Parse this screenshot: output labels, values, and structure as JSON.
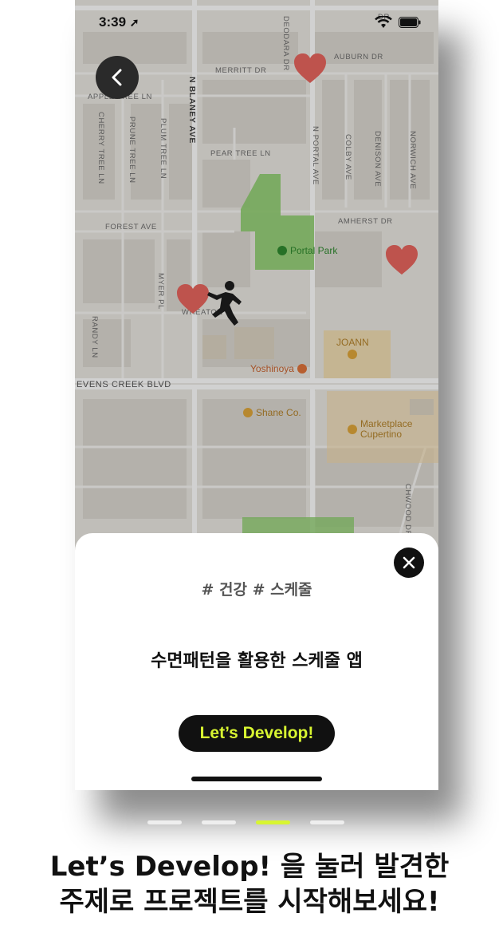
{
  "status_bar": {
    "time": "3:39"
  },
  "map": {
    "streets": {
      "merritt": "MERRITT DR",
      "auburn": "AUBURN DR",
      "apple_tree": "APPLE TREE LN",
      "deodara": "DEODARA DR",
      "dr_top": "DR",
      "n_blaney": "N BLANEY AVE",
      "cherry_tree": "CHERRY TREE LN",
      "prune_tree": "PRUNE TREE LN",
      "plum_tree": "PLUM TREE LN",
      "pear_tree": "PEAR TREE LN",
      "n_portal": "N PORTAL AVE",
      "colby": "COLBY AVE",
      "denison": "DENISON AVE",
      "norwich": "NORWICH AVE",
      "forest": "FOREST AVE",
      "amherst": "AMHERST DR",
      "myer": "MYER PL",
      "wheaton": "WHEATON",
      "randy": "RANDY LN",
      "stevens_creek": "EVENS CREEK BLVD",
      "wood": "CHWOOD DR"
    },
    "pois": {
      "portal_park": "Portal Park",
      "joann": "JOANN",
      "yoshinoya": "Yoshinoya",
      "shane": "Shane Co.",
      "marketplace_1": "Marketplace",
      "marketplace_2": "Cupertino"
    }
  },
  "sheet": {
    "tags": "# 건강 # 스케줄",
    "title": "수면패턴을 활용한 스케줄 앱",
    "button_label": "Let’s Develop!"
  },
  "pager": {
    "count": 4,
    "active_index": 2
  },
  "caption": {
    "line1": "Let’s Develop! 을 눌러 발견한",
    "line2": "주제로 프로젝트를 시작해보세요!"
  },
  "colors": {
    "accent": "#d8f531",
    "heart": "#e8665e",
    "park": "#8fce6f",
    "poi_orange": "#e0733a",
    "poi_yellow": "#e0a73a"
  }
}
